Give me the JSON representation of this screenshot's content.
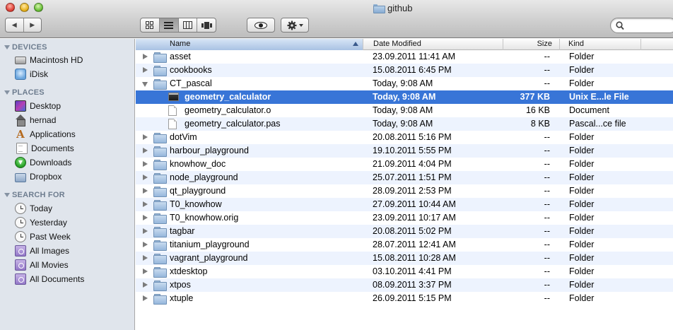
{
  "window": {
    "title": "github"
  },
  "toolbar": {
    "back_label": "◀",
    "forward_label": "▶",
    "views": [
      "icon-view",
      "list-view",
      "column-view",
      "coverflow-view"
    ],
    "active_view": "list-view",
    "search": {
      "value": "",
      "placeholder": ""
    }
  },
  "sidebar": {
    "devices": {
      "title": "DEVICES",
      "items": [
        {
          "label": "Macintosh HD",
          "icon": "hard-drive-icon"
        },
        {
          "label": "iDisk",
          "icon": "idisk-icon"
        }
      ]
    },
    "places": {
      "title": "PLACES",
      "items": [
        {
          "label": "Desktop",
          "icon": "desktop-icon"
        },
        {
          "label": "hernad",
          "icon": "home-icon"
        },
        {
          "label": "Applications",
          "icon": "applications-icon"
        },
        {
          "label": "Documents",
          "icon": "documents-icon"
        },
        {
          "label": "Downloads",
          "icon": "downloads-icon"
        },
        {
          "label": "Dropbox",
          "icon": "dropbox-icon"
        }
      ]
    },
    "search_for": {
      "title": "SEARCH FOR",
      "items": [
        {
          "label": "Today",
          "icon": "clock-icon"
        },
        {
          "label": "Yesterday",
          "icon": "clock-icon"
        },
        {
          "label": "Past Week",
          "icon": "clock-icon"
        },
        {
          "label": "All Images",
          "icon": "smart-folder-icon"
        },
        {
          "label": "All Movies",
          "icon": "smart-folder-icon"
        },
        {
          "label": "All Documents",
          "icon": "smart-folder-icon"
        }
      ]
    }
  },
  "columns": {
    "name": "Name",
    "date": "Date Modified",
    "size": "Size",
    "kind": "Kind"
  },
  "files": [
    {
      "name": "asset",
      "date": "23.09.2011 11:41 AM",
      "size": "--",
      "kind": "Folder",
      "type": "folder",
      "level": 0,
      "expanded": false
    },
    {
      "name": "cookbooks",
      "date": "15.08.2011 6:45 PM",
      "size": "--",
      "kind": "Folder",
      "type": "folder",
      "level": 0,
      "expanded": false
    },
    {
      "name": "CT_pascal",
      "date": "Today, 9:08 AM",
      "size": "--",
      "kind": "Folder",
      "type": "folder",
      "level": 0,
      "expanded": true
    },
    {
      "name": "geometry_calculator",
      "date": "Today, 9:08 AM",
      "size": "377 KB",
      "kind": "Unix E...le File",
      "type": "exec",
      "level": 1,
      "selected": true
    },
    {
      "name": "geometry_calculator.o",
      "date": "Today, 9:08 AM",
      "size": "16 KB",
      "kind": "Document",
      "type": "file",
      "level": 1
    },
    {
      "name": "geometry_calculator.pas",
      "date": "Today, 9:08 AM",
      "size": "8 KB",
      "kind": "Pascal...ce file",
      "type": "file",
      "level": 1
    },
    {
      "name": "dotVim",
      "date": "20.08.2011 5:16 PM",
      "size": "--",
      "kind": "Folder",
      "type": "folder",
      "level": 0,
      "expanded": false
    },
    {
      "name": "harbour_playground",
      "date": "19.10.2011 5:55 PM",
      "size": "--",
      "kind": "Folder",
      "type": "folder",
      "level": 0,
      "expanded": false
    },
    {
      "name": "knowhow_doc",
      "date": "21.09.2011 4:04 PM",
      "size": "--",
      "kind": "Folder",
      "type": "folder",
      "level": 0,
      "expanded": false
    },
    {
      "name": "node_playground",
      "date": "25.07.2011 1:51 PM",
      "size": "--",
      "kind": "Folder",
      "type": "folder",
      "level": 0,
      "expanded": false
    },
    {
      "name": "qt_playground",
      "date": "28.09.2011 2:53 PM",
      "size": "--",
      "kind": "Folder",
      "type": "folder",
      "level": 0,
      "expanded": false
    },
    {
      "name": "T0_knowhow",
      "date": "27.09.2011 10:44 AM",
      "size": "--",
      "kind": "Folder",
      "type": "folder",
      "level": 0,
      "expanded": false
    },
    {
      "name": "T0_knowhow.orig",
      "date": "23.09.2011 10:17 AM",
      "size": "--",
      "kind": "Folder",
      "type": "folder",
      "level": 0,
      "expanded": false
    },
    {
      "name": "tagbar",
      "date": "20.08.2011 5:02 PM",
      "size": "--",
      "kind": "Folder",
      "type": "folder",
      "level": 0,
      "expanded": false
    },
    {
      "name": "titanium_playground",
      "date": "28.07.2011 12:41 AM",
      "size": "--",
      "kind": "Folder",
      "type": "folder",
      "level": 0,
      "expanded": false
    },
    {
      "name": "vagrant_playground",
      "date": "15.08.2011 10:28 AM",
      "size": "--",
      "kind": "Folder",
      "type": "folder",
      "level": 0,
      "expanded": false
    },
    {
      "name": "xtdesktop",
      "date": "03.10.2011 4:41 PM",
      "size": "--",
      "kind": "Folder",
      "type": "folder",
      "level": 0,
      "expanded": false
    },
    {
      "name": "xtpos",
      "date": "08.09.2011 3:37 PM",
      "size": "--",
      "kind": "Folder",
      "type": "folder",
      "level": 0,
      "expanded": false
    },
    {
      "name": "xtuple",
      "date": "26.09.2011 5:15 PM",
      "size": "--",
      "kind": "Folder",
      "type": "folder",
      "level": 0,
      "expanded": false
    }
  ],
  "colors": {
    "selection": "#3875d7",
    "alt_row": "#edf3fe",
    "sidebar_bg": "#e0e5ec",
    "sidebar_header": "#6e7d8f"
  }
}
